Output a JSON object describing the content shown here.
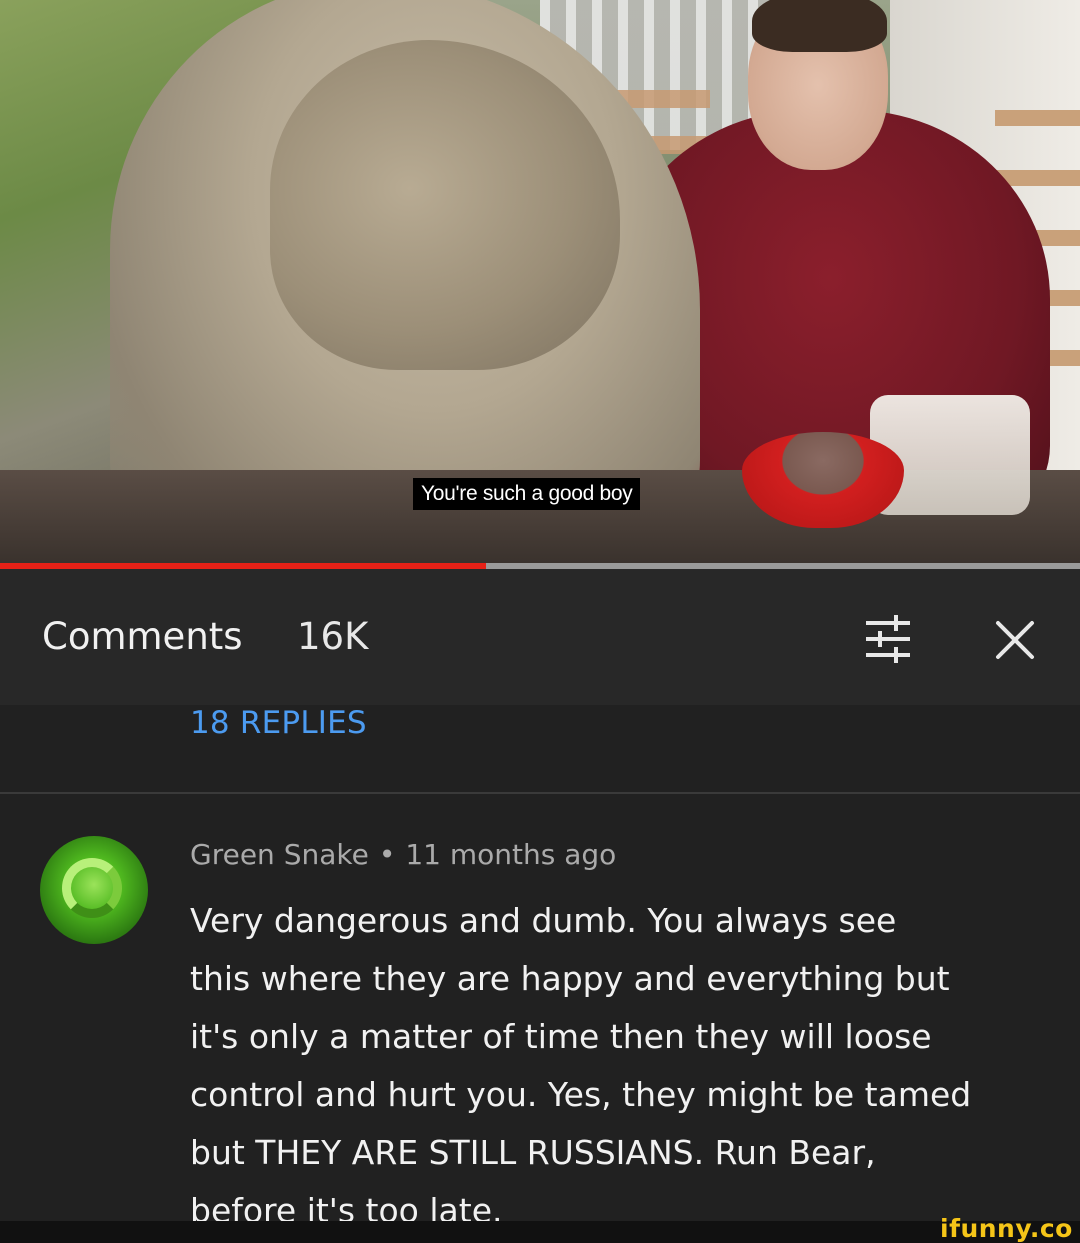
{
  "video": {
    "subtitle": "You're such a good boy",
    "progress_fraction": 0.45
  },
  "comments_panel": {
    "title": "Comments",
    "count": "16K",
    "icons": {
      "filter": "sort-filter-icon",
      "close": "close-icon"
    },
    "replies_link": "18 REPLIES"
  },
  "comment": {
    "author": "Green Snake",
    "separator": "•",
    "time": "11 months ago",
    "avatar_icon": "snake-avatar",
    "lines": [
      "Very dangerous and dumb. You always see",
      "this where they are happy and everything but",
      "it's only a matter of time then they will loose",
      "control and hurt you. Yes, they might be tamed",
      "but THEY ARE STILL RUSSIANS. Run Bear,",
      "before it's too late."
    ]
  },
  "watermark": "ifunny.co",
  "colors": {
    "background": "#212121",
    "header": "#282828",
    "progress": "#e62117",
    "link": "#4c9bf0",
    "watermark": "#f5c518"
  }
}
